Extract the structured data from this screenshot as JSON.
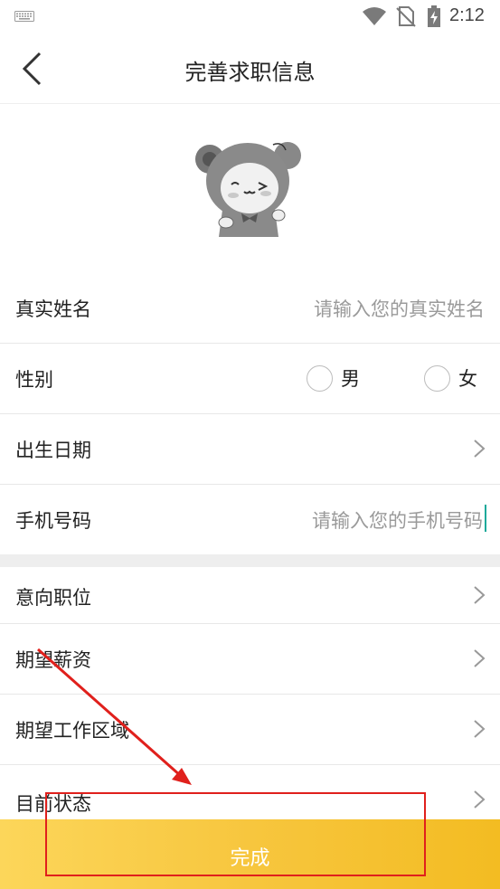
{
  "status_bar": {
    "time": "2:12"
  },
  "header": {
    "title": "完善求职信息"
  },
  "form": {
    "name": {
      "label": "真实姓名",
      "placeholder": "请输入您的真实姓名"
    },
    "gender": {
      "label": "性别",
      "options": [
        "男",
        "女"
      ]
    },
    "birth_date": {
      "label": "出生日期"
    },
    "phone": {
      "label": "手机号码",
      "placeholder": "请输入您的手机号码"
    },
    "intended_position": {
      "label": "意向职位"
    },
    "expected_salary": {
      "label": "期望薪资"
    },
    "expected_area": {
      "label": "期望工作区域"
    },
    "current_status": {
      "label": "目前状态"
    }
  },
  "submit_button": {
    "label": "完成"
  },
  "colors": {
    "accent_gradient_start": "#fcd65a",
    "accent_gradient_end": "#f3bc22",
    "annotation": "#e0201c",
    "cursor": "#1aa99a"
  }
}
